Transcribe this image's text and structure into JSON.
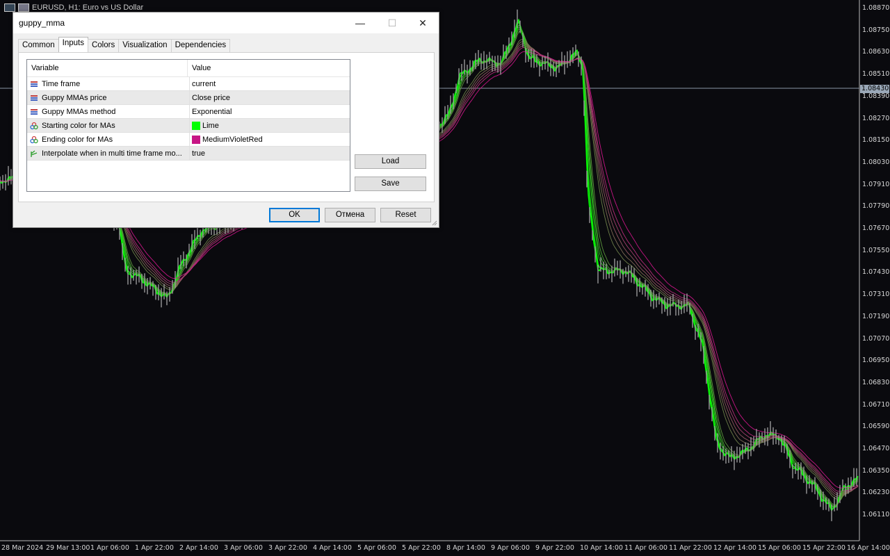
{
  "chart": {
    "title": "EURUSD, H1:  Euro vs US Dollar",
    "current_price": "1.08430",
    "price_labels": [
      "1.08870",
      "1.08750",
      "1.08630",
      "1.08510",
      "1.08390",
      "1.08270",
      "1.08150",
      "1.08030",
      "1.07910",
      "1.07790",
      "1.07670",
      "1.07550",
      "1.07430",
      "1.07310",
      "1.07190",
      "1.07070",
      "1.06950",
      "1.06830",
      "1.06710",
      "1.06590",
      "1.06470",
      "1.06350",
      "1.06230",
      "1.06110"
    ],
    "time_labels": [
      "28 Mar 2024",
      "29 Mar 13:00",
      "1 Apr 06:00",
      "1 Apr 22:00",
      "2 Apr 14:00",
      "3 Apr 06:00",
      "3 Apr 22:00",
      "4 Apr 14:00",
      "5 Apr 06:00",
      "5 Apr 22:00",
      "8 Apr 14:00",
      "9 Apr 06:00",
      "9 Apr 22:00",
      "10 Apr 14:00",
      "11 Apr 06:00",
      "11 Apr 22:00",
      "12 Apr 14:00",
      "15 Apr 06:00",
      "15 Apr 22:00",
      "16 Apr 14:00"
    ],
    "colors": {
      "start": "#00ff00",
      "end": "#c71585",
      "candle": "#9a9a9a",
      "bg": "#0a0a0e"
    }
  },
  "dialog": {
    "title": "guppy_mma",
    "window_buttons": {
      "minimize": "—",
      "maximize": "☐",
      "close": "✕"
    },
    "tabs": [
      {
        "label": "Common",
        "active": false
      },
      {
        "label": "Inputs",
        "active": true
      },
      {
        "label": "Colors",
        "active": false
      },
      {
        "label": "Visualization",
        "active": false
      },
      {
        "label": "Dependencies",
        "active": false
      }
    ],
    "grid": {
      "headers": {
        "variable": "Variable",
        "value": "Value"
      },
      "rows": [
        {
          "icon": "enum-icon",
          "variable": "Time frame",
          "value": "current"
        },
        {
          "icon": "enum-icon",
          "variable": "Guppy MMAs price",
          "value": "Close price"
        },
        {
          "icon": "enum-icon",
          "variable": "Guppy MMAs method",
          "value": "Exponential"
        },
        {
          "icon": "color-icon",
          "variable": "Starting color for MAs",
          "value": "Lime",
          "swatch": "#00ff00"
        },
        {
          "icon": "color-icon",
          "variable": "Ending color for MAs",
          "value": "MediumVioletRed",
          "swatch": "#c71585"
        },
        {
          "icon": "bool-icon",
          "variable": "Interpolate when in multi time frame mo...",
          "value": "true"
        }
      ]
    },
    "buttons": {
      "load": "Load",
      "save": "Save",
      "ok": "OK",
      "cancel": "Отмена",
      "reset": "Reset"
    }
  }
}
